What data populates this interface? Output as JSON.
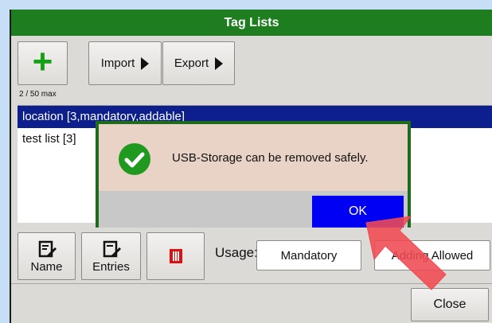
{
  "window": {
    "title": "Tag Lists"
  },
  "toolbar": {
    "add_icon": "plus-icon",
    "import_label": "Import",
    "export_label": "Export",
    "max_count": "2 / 50 max"
  },
  "list": {
    "items": [
      {
        "label": "location [3,mandatory,addable]",
        "selected": true
      },
      {
        "label": "test list [3]",
        "selected": false
      }
    ]
  },
  "bottom": {
    "name_label": "Name",
    "entries_label": "Entries",
    "usage_label": "Usage:",
    "usage_value": "Mandatory",
    "adding_label": "Adding Allowed",
    "close_label": "Close"
  },
  "dialog": {
    "message": "USB-Storage can be removed safely.",
    "ok_label": "OK",
    "icon": "checkmark-circle-icon"
  },
  "colors": {
    "titlebar": "#1e7d1e",
    "selection": "#0c1f8c",
    "ok_button": "#0000f2",
    "arrow": "#f04a52",
    "delete_icon": "#e01010"
  }
}
